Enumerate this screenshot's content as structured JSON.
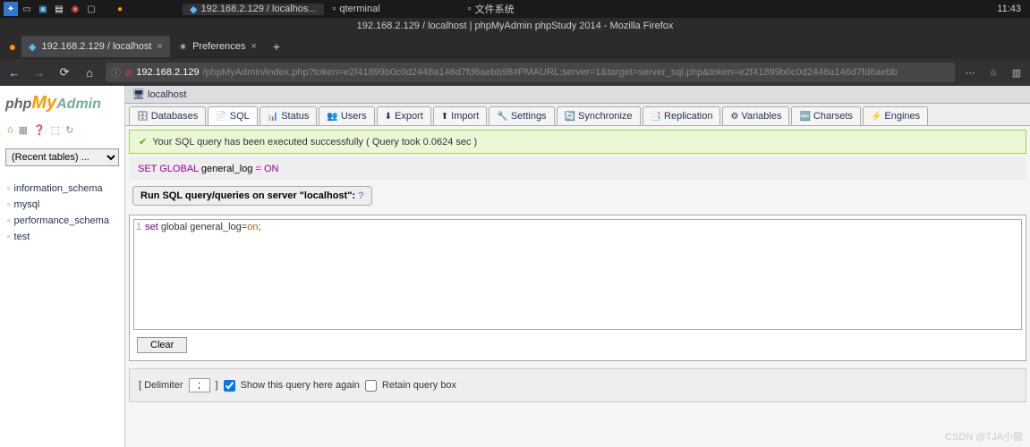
{
  "taskbar": {
    "items": [
      "192.168.2.129 / localhos...",
      "qterminal",
      "文件系统"
    ],
    "clock": "11:43"
  },
  "window_title": "192.168.2.129 / localhost | phpMyAdmin phpStudy 2014 - Mozilla Firefox",
  "browser_tabs": [
    {
      "label": "192.168.2.129 / localhost"
    },
    {
      "label": "Preferences"
    }
  ],
  "url": {
    "host": "192.168.2.129",
    "path": "/phpMyAdmin/index.php?token=e2f41899b0c0d2448a146d7fd6aebb98#PMAURL:server=1&target=server_sql.php&token=e2f41899b0c0d2448a146d7fd6aebb"
  },
  "sidebar": {
    "recent_label": "(Recent tables) ...",
    "dbs": [
      "information_schema",
      "mysql",
      "performance_schema",
      "test"
    ]
  },
  "breadcrumb": "localhost",
  "main_tabs": [
    "Databases",
    "SQL",
    "Status",
    "Users",
    "Export",
    "Import",
    "Settings",
    "Synchronize",
    "Replication",
    "Variables",
    "Charsets",
    "Engines"
  ],
  "success_msg": "Your SQL query has been executed successfully ( Query took 0.0624 sec )",
  "sql_display": {
    "p1": "SET GLOBAL",
    "p2": " general_log ",
    "p3": "=",
    "p4": " ON"
  },
  "panel_title": "Run SQL query/queries on server \"localhost\": ",
  "editor_text": {
    "ln": "1",
    "kw": "set",
    "body": " global general_log=",
    "val": "on",
    "end": ";"
  },
  "clear_label": "Clear",
  "opts": {
    "delim_label_l": "[ Delimiter ",
    "delim_val": ";",
    "delim_label_r": " ]",
    "show_again": "Show this query here again",
    "retain": "Retain query box"
  },
  "watermark": "CSDN @TJA小傲"
}
